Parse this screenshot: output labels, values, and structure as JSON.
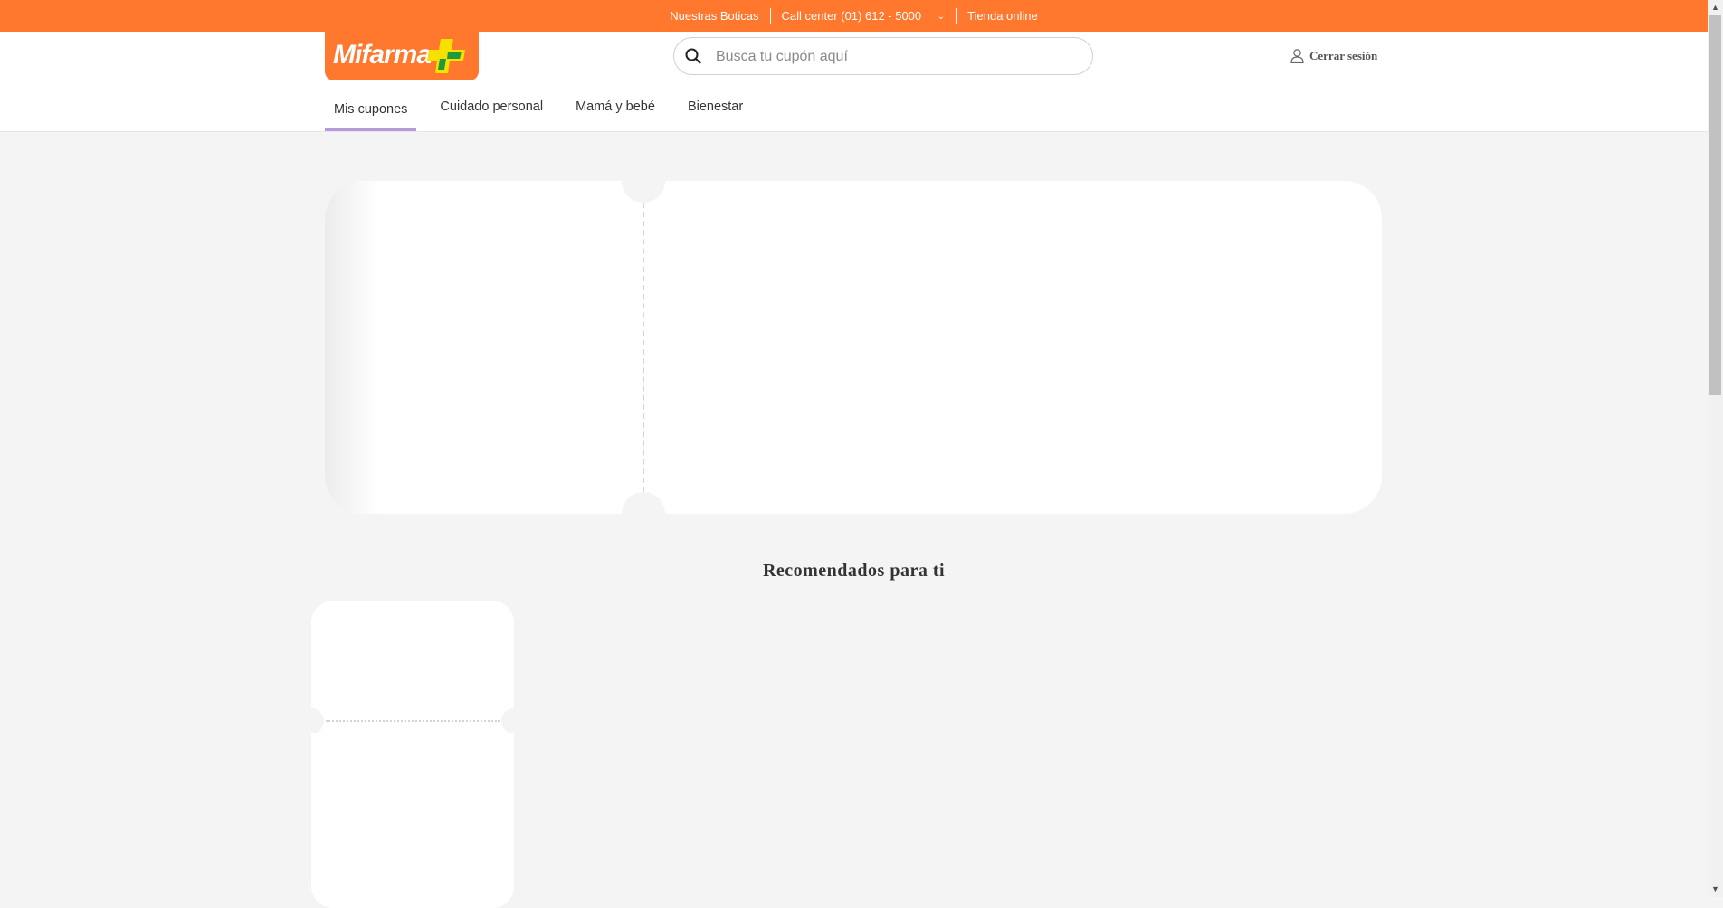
{
  "topbar": {
    "boticas": "Nuestras Boticas",
    "callcenter": "Call center (01) 612 - 5000",
    "chevron": "⌄",
    "tienda": "Tienda online"
  },
  "header": {
    "logo_text": "Mifarma",
    "search_placeholder": "Busca tu cupón aquí",
    "logout_label": "Cerrar sesión"
  },
  "nav": {
    "tabs": [
      {
        "label": "Mis cupones",
        "active": true
      },
      {
        "label": "Cuidado personal",
        "active": false
      },
      {
        "label": "Mamá y bebé",
        "active": false
      },
      {
        "label": "Bienestar",
        "active": false
      }
    ]
  },
  "recommended": {
    "title": "Recomendados para ti"
  },
  "colors": {
    "brand": "#ff782e",
    "tab_underline": "#b69ad9",
    "cross_yellow": "#f5e000",
    "cross_green": "#1e9a3c"
  },
  "icons": {
    "search": "search-icon",
    "user": "user-icon",
    "chevron": "chevron-down-icon",
    "logo_cross": "logo-cross-icon"
  }
}
